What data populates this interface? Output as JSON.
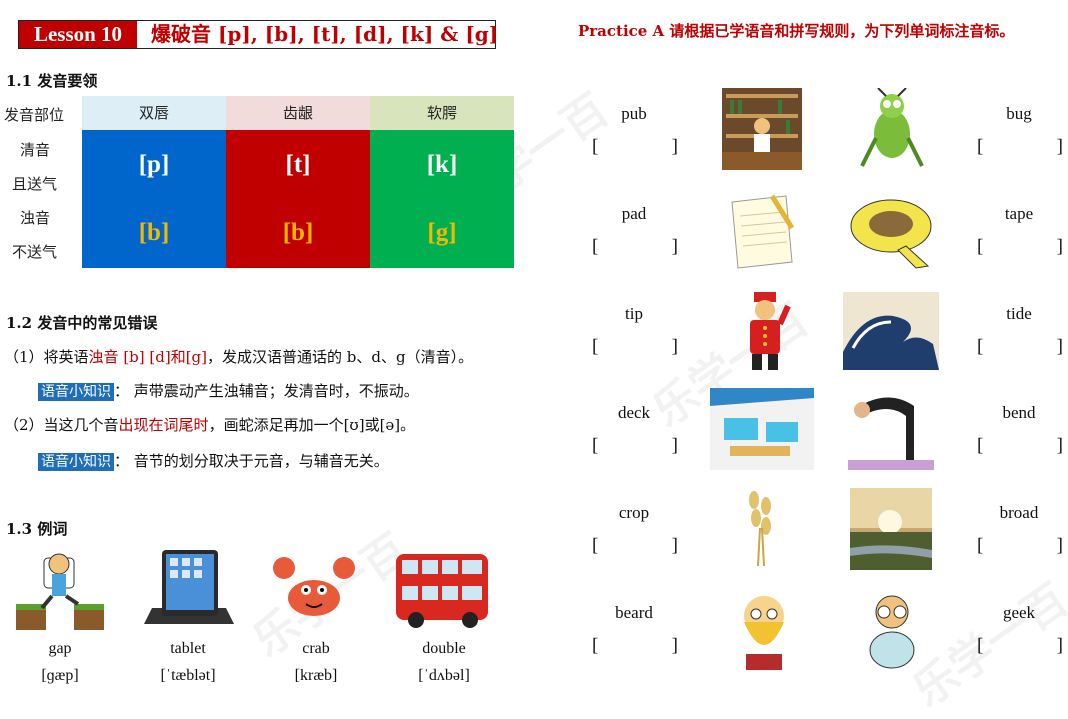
{
  "header": {
    "lesson": "Lesson 10",
    "title": "爆破音 [p], [b], [t], [d], [k] & [g]"
  },
  "section1": {
    "heading": "1.1 发音要领",
    "row_labels": {
      "place": "发音部位",
      "voiceless_1": "清音",
      "voiceless_2": "且送气",
      "voiced_1": "浊音",
      "voiced_2": "不送气"
    },
    "columns": [
      "双唇",
      "齿龈",
      "软腭"
    ],
    "voiceless": [
      "[p]",
      "[t]",
      "[k]"
    ],
    "voiced": [
      "[b]",
      "[b]",
      "[g]"
    ]
  },
  "section2": {
    "heading": "1.2 发音中的常见错误",
    "line1_pre": "（1）将英语",
    "line1_red": "浊音 [b] [d]和[g]",
    "line1_post": "，发成汉语普通话的 b、d、g（清音）。",
    "tip_label": "语音小知识",
    "tip1": "： 声带震动产生浊辅音；发清音时，不振动。",
    "line2_pre": "（2）当这几个音",
    "line2_red": "出现在词尾时",
    "line2_post": "，画蛇添足再加一个[ʊ]或[ə]。",
    "tip2": "： 音节的划分取决于元音，与辅音无关。"
  },
  "section3": {
    "heading": "1.3 例词",
    "examples": [
      {
        "word": "gap",
        "ipa": "[ɡæp]"
      },
      {
        "word": "tablet",
        "ipa": "[ˈtæblət]"
      },
      {
        "word": "crab",
        "ipa": "[kræb]"
      },
      {
        "word": "double",
        "ipa": "[ˈdʌbəl]"
      }
    ]
  },
  "practice": {
    "title": "Practice A  请根据已学语音和拼写规则，为下列单词标注音标。",
    "left_words": [
      "pub",
      "pad",
      "tip",
      "deck",
      "crop",
      "beard"
    ],
    "right_words": [
      "bug",
      "tape",
      "tide",
      "bend",
      "broad",
      "geek"
    ],
    "bracket_open": "[",
    "bracket_close": "]"
  },
  "colors": {
    "accent_red": "#c00000",
    "blue_cell": "#0066cc",
    "red_cell": "#c00000",
    "green_cell": "#00b050",
    "voiced_text": "#f5b800",
    "tip_blue": "#1f6fb8"
  }
}
